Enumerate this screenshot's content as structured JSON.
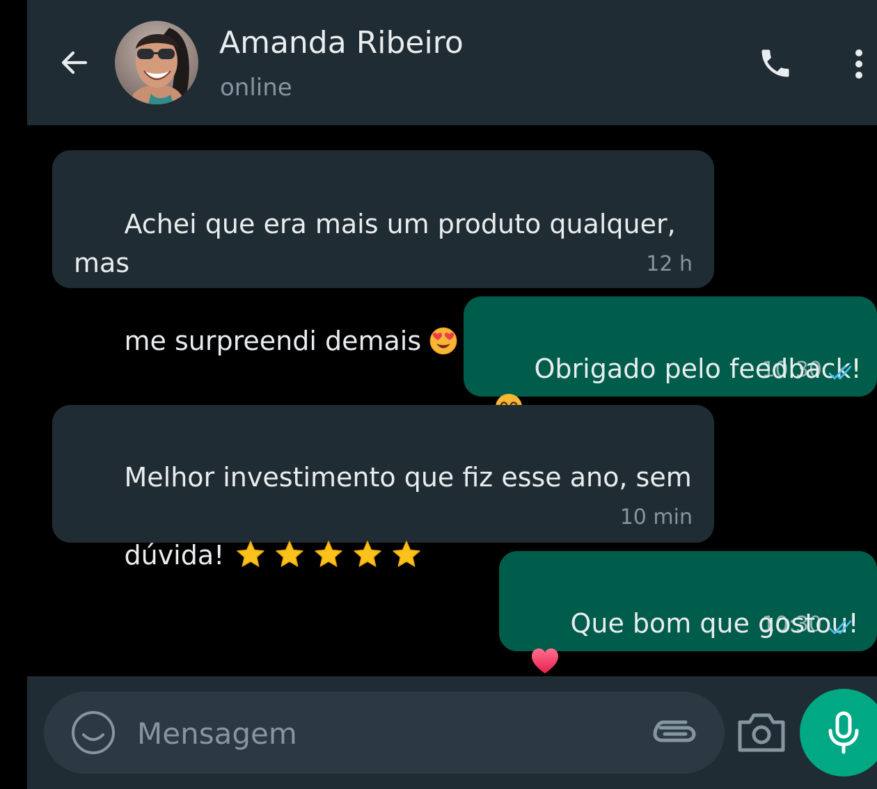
{
  "header": {
    "contact_name": "Amanda Ribeiro",
    "status": "online"
  },
  "messages": [
    {
      "direction": "incoming",
      "lines": [
        "Achei que era mais um produto qualquer, mas",
        "me surpreendi demais"
      ],
      "emoji": "heart-eyes-emoji",
      "time": "12 h"
    },
    {
      "direction": "outgoing",
      "lines": [
        "Obrigado pelo feedback!"
      ],
      "emoji": "smiling-face-emoji",
      "time": "10:30",
      "read": true
    },
    {
      "direction": "incoming",
      "lines": [
        "Melhor investimento que fiz esse ano, sem",
        "dúvida!"
      ],
      "emoji": "star-emoji",
      "emoji_count": 5,
      "time": "10 min"
    },
    {
      "direction": "outgoing",
      "lines": [
        "Que bom que gostou!"
      ],
      "emoji": "red-heart-emoji",
      "time": "10:30",
      "read": true
    }
  ],
  "composer": {
    "placeholder": "Mensagem"
  },
  "colors": {
    "header_bg": "#202c33",
    "incoming_bubble": "#202c33",
    "outgoing_bubble": "#005c4b",
    "accent": "#00a884",
    "read_ticks": "#53bdeb"
  }
}
